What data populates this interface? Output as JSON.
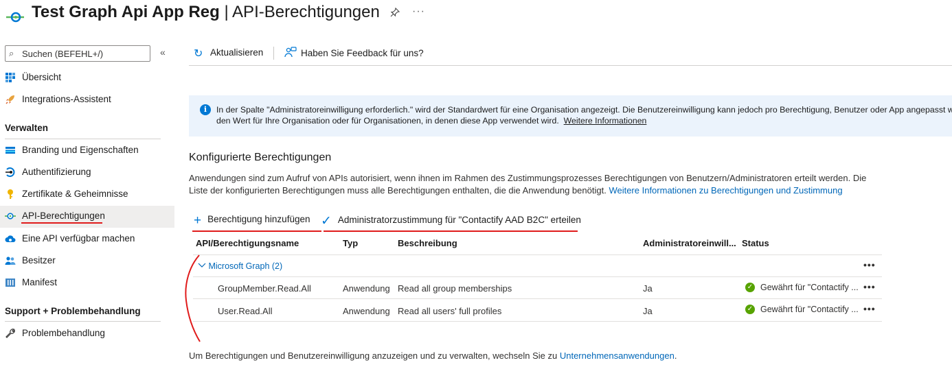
{
  "header": {
    "app_name": "Test Graph Api App Reg",
    "separator": " | ",
    "page_title": "API-Berechtigungen",
    "more": "···"
  },
  "sidebar": {
    "search_placeholder": "Suchen (BEFEHL+/)",
    "collapse": "«",
    "items_top": [
      {
        "label": "Übersicht",
        "icon": "grid-icon"
      },
      {
        "label": "Integrations-Assistent",
        "icon": "rocket-icon"
      }
    ],
    "section_manage": "Verwalten",
    "items_manage": [
      {
        "label": "Branding und Eigenschaften",
        "icon": "branding-icon"
      },
      {
        "label": "Authentifizierung",
        "icon": "auth-icon"
      },
      {
        "label": "Zertifikate & Geheimnisse",
        "icon": "key-icon"
      },
      {
        "label": "API-Berechtigungen",
        "icon": "api-permissions-icon",
        "active": true
      },
      {
        "label": "Eine API verfügbar machen",
        "icon": "cloud-icon"
      },
      {
        "label": "Besitzer",
        "icon": "users-icon"
      },
      {
        "label": "Manifest",
        "icon": "manifest-icon"
      }
    ],
    "section_support": "Support + Problembehandlung",
    "items_support": [
      {
        "label": "Problembehandlung",
        "icon": "wrench-icon"
      }
    ]
  },
  "toolbar": {
    "refresh": "Aktualisieren",
    "feedback": "Haben Sie Feedback für uns?"
  },
  "banner": {
    "line1": "In der Spalte \"Administratoreinwilligung erforderlich.\" wird der Standardwert für eine Organisation angezeigt. Die Benutzereinwilligung kann jedoch pro Berechtigung, Benutzer oder App angepasst wer",
    "line2": "den Wert für Ihre Organisation oder für Organisationen, in denen diese App verwendet wird.",
    "link": "Weitere Informationen"
  },
  "configured": {
    "title": "Konfigurierte Berechtigungen",
    "desc": "Anwendungen sind zum Aufruf von APIs autorisiert, wenn ihnen im Rahmen des Zustimmungsprozesses Berechtigungen von Benutzern/Administratoren erteilt werden. Die Liste der konfigurierten Berechtigungen muss alle Berechtigungen enthalten, die die Anwendung benötigt.",
    "desc_link": "Weitere Informationen zu Berechtigungen und Zustimmung"
  },
  "actions": {
    "add": "Berechtigung hinzufügen",
    "grant": "Administratorzustimmung für \"Contactify AAD B2C\" erteilen"
  },
  "table": {
    "headers": [
      "API/Berechtigungsname",
      "Typ",
      "Beschreibung",
      "Administratoreinwill...",
      "Status"
    ],
    "group": "Microsoft Graph (2)",
    "rows": [
      {
        "name": "GroupMember.Read.All",
        "type": "Anwendung",
        "description": "Read all group memberships",
        "admin": "Ja",
        "status": "Gewährt für \"Contactify ..."
      },
      {
        "name": "User.Read.All",
        "type": "Anwendung",
        "description": "Read all users' full profiles",
        "admin": "Ja",
        "status": "Gewährt für \"Contactify ..."
      }
    ],
    "more": "•••"
  },
  "footer": {
    "text": "Um Berechtigungen und Benutzereinwilligung anzuzeigen und zu verwalten, wechseln Sie zu",
    "link": "Unternehmensanwendungen",
    "end": "."
  },
  "colors": {
    "accent": "#0078d4",
    "annotation": "#e01b1b",
    "success": "#57a300"
  }
}
